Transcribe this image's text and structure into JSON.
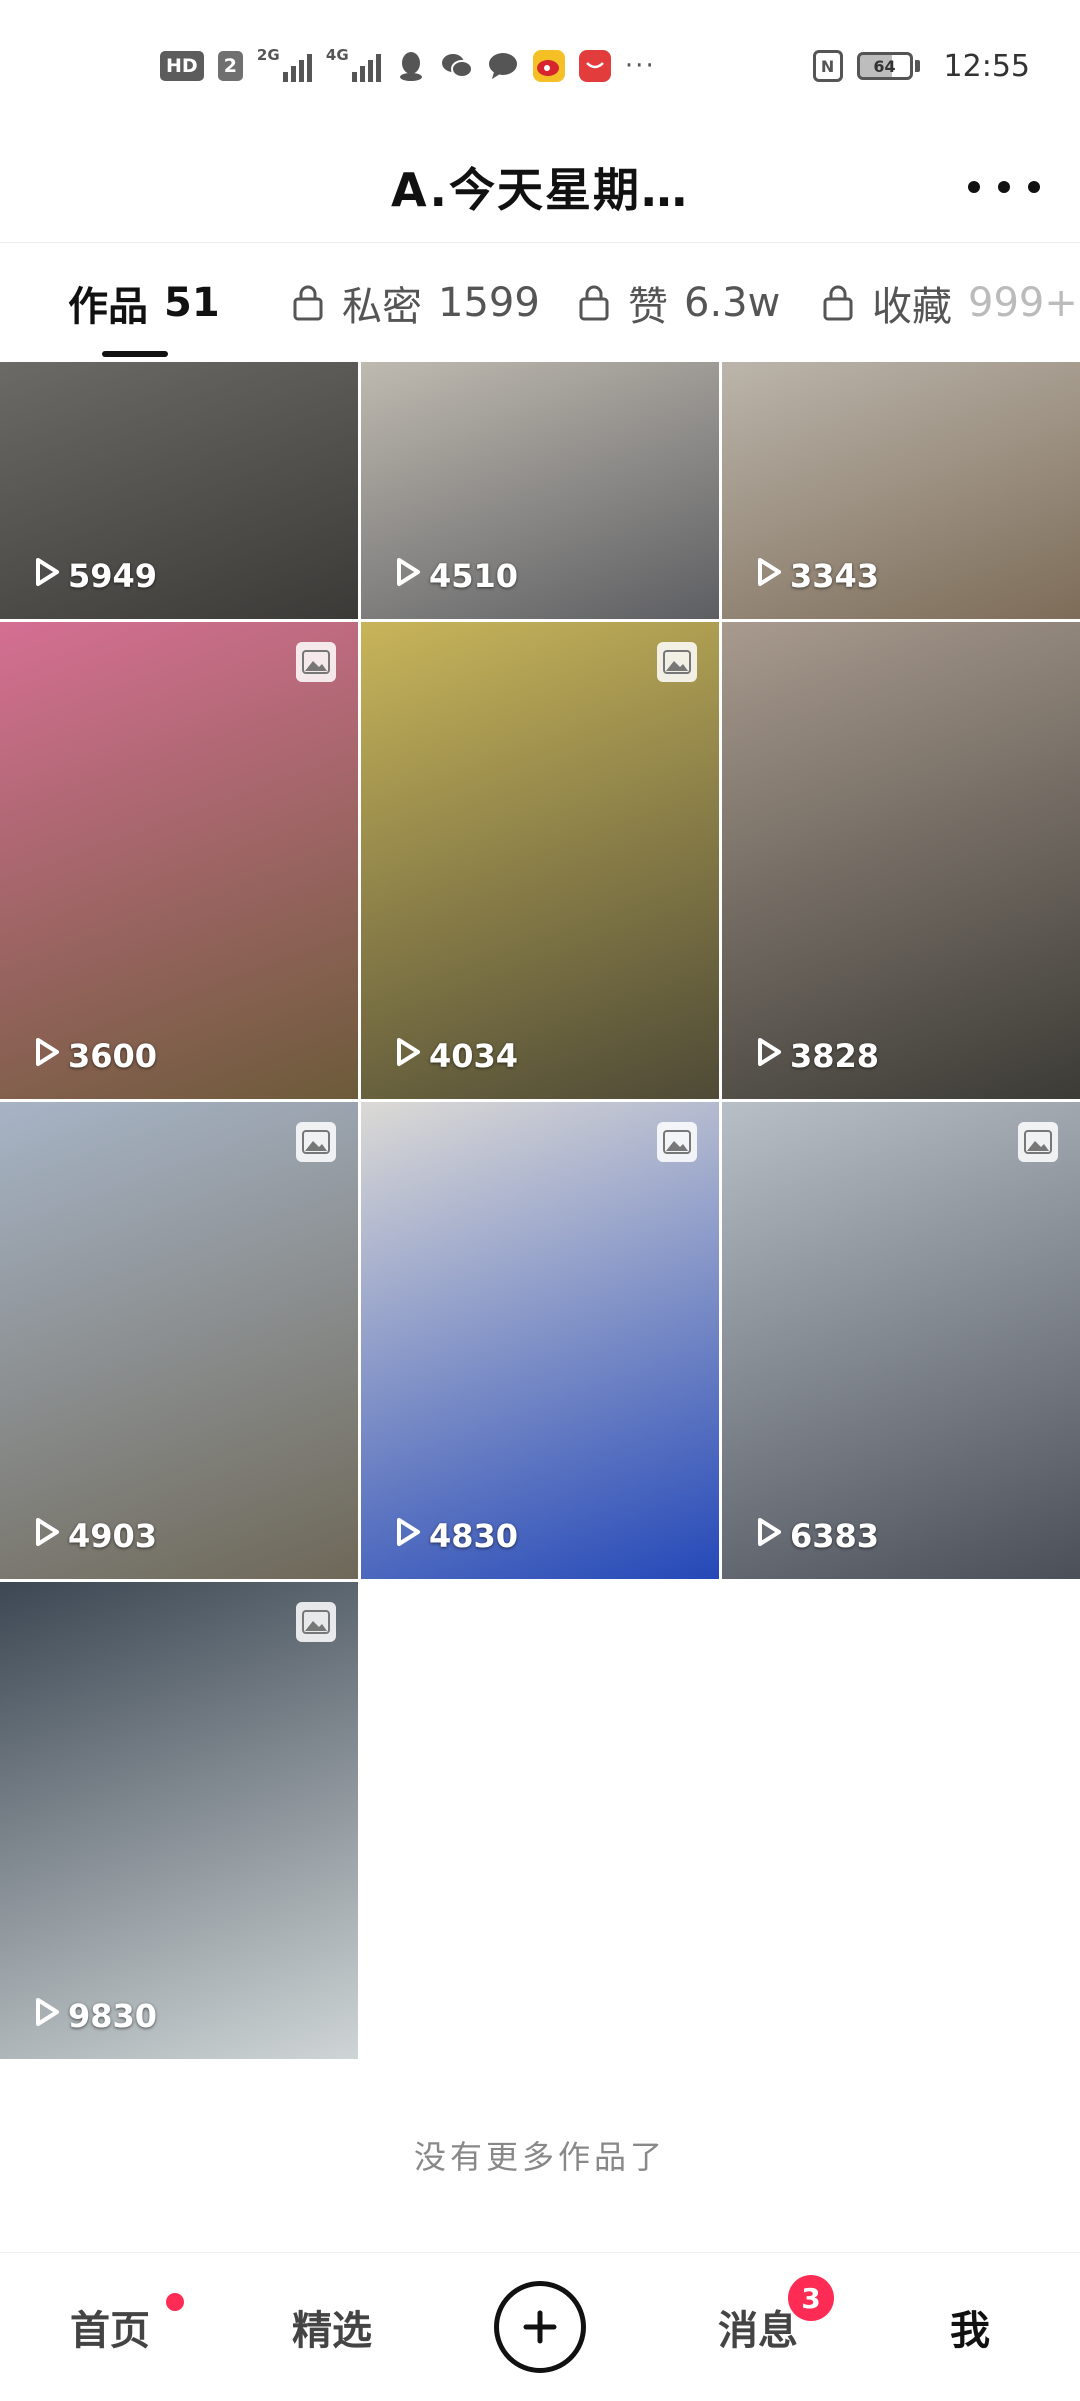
{
  "status_bar": {
    "hd": "HD",
    "sim": "2",
    "net1": "2G",
    "net2": "4G",
    "battery": "64",
    "time": "12:55",
    "icons": [
      "qq-icon",
      "wechat-icon",
      "message-icon",
      "weibo-icon",
      "huawei-icon",
      "more-dots-icon",
      "nfc-icon",
      "battery-icon"
    ]
  },
  "header": {
    "title": "A.今天星期…",
    "more_icon": "more-dots-icon"
  },
  "tabs": [
    {
      "label": "作品",
      "count": "51",
      "active": true
    },
    {
      "label": "私密",
      "count": "1599",
      "locked": true
    },
    {
      "label": "赞",
      "count": "6.3w",
      "locked": true
    },
    {
      "label": "收藏",
      "count": "999+",
      "locked": true
    }
  ],
  "videos": [
    {
      "plays": "5949",
      "photo": false,
      "colors": [
        "#6b6a66",
        "#3b3a37"
      ]
    },
    {
      "plays": "4510",
      "photo": false,
      "colors": [
        "#bfbab0",
        "#5d5e62"
      ]
    },
    {
      "plays": "3343",
      "photo": false,
      "colors": [
        "#bbb5ab",
        "#7d6c58"
      ]
    },
    {
      "plays": "3600",
      "photo": true,
      "colors": [
        "#d56f93",
        "#6c5b3a"
      ]
    },
    {
      "plays": "4034",
      "photo": true,
      "colors": [
        "#c8b55a",
        "#4e4a36"
      ]
    },
    {
      "plays": "3828",
      "photo": false,
      "colors": [
        "#a89a8e",
        "#3c3b36"
      ]
    },
    {
      "plays": "4903",
      "photo": true,
      "colors": [
        "#a7b4c6",
        "#6e6858"
      ]
    },
    {
      "plays": "4830",
      "photo": true,
      "colors": [
        "#dcdad6",
        "#2448b8"
      ]
    },
    {
      "plays": "6383",
      "photo": true,
      "colors": [
        "#b8bfc7",
        "#4b4f58"
      ]
    },
    {
      "plays": "9830",
      "photo": true,
      "colors": [
        "#3c4753",
        "#cfd5d6"
      ]
    }
  ],
  "footer_text": "没有更多作品了",
  "bottom_nav": {
    "home": "首页",
    "featured": "精选",
    "messages": "消息",
    "messages_badge": "3",
    "me": "我",
    "create_icon": "plus-circle-icon"
  },
  "colors": {
    "accent": "#fe2c55",
    "text": "#161616"
  }
}
